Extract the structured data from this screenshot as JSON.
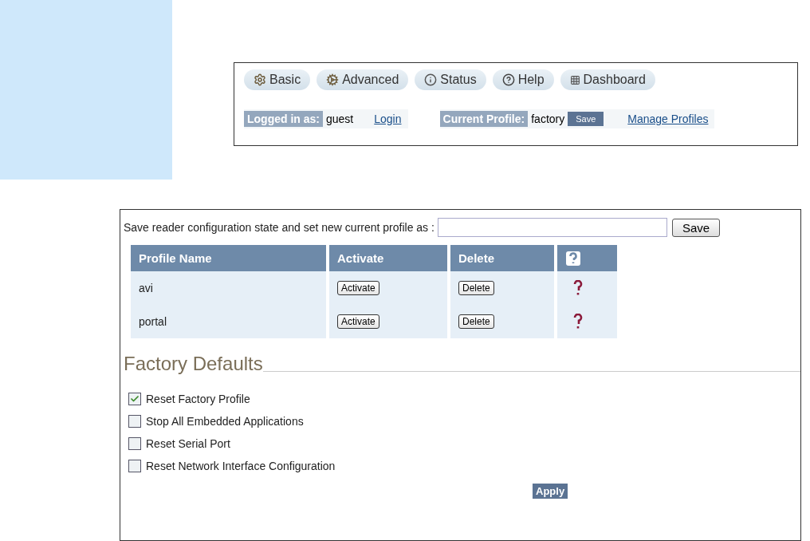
{
  "nav_tabs": [
    {
      "label": "Basic",
      "kind": "gear"
    },
    {
      "label": "Advanced",
      "kind": "cogs"
    },
    {
      "label": "Status",
      "kind": "info"
    },
    {
      "label": "Help",
      "kind": "help"
    },
    {
      "label": "Dashboard",
      "kind": "grid"
    }
  ],
  "session": {
    "logged_in_label": "Logged in as:",
    "user": "guest",
    "login_link": "Login",
    "profile_label": "Current Profile:",
    "profile": "factory",
    "save_button": "Save",
    "manage_link": "Manage Profiles"
  },
  "save_profile": {
    "label": "Save reader configuration state and set new current profile as :",
    "button": "Save"
  },
  "profiles_table": {
    "columns": [
      "Profile Name",
      "Activate",
      "Delete"
    ],
    "rows": [
      {
        "name": "avi",
        "activate": "Activate",
        "delete": "Delete"
      },
      {
        "name": "portal",
        "activate": "Activate",
        "delete": "Delete"
      }
    ]
  },
  "factory_defaults": {
    "title": "Factory Defaults",
    "options": [
      {
        "label": "Reset Factory Profile",
        "checked": true
      },
      {
        "label": "Stop All Embedded Applications",
        "checked": false
      },
      {
        "label": "Reset Serial Port",
        "checked": false
      },
      {
        "label": "Reset Network Interface Configuration",
        "checked": false
      }
    ],
    "apply_button": "Apply"
  }
}
